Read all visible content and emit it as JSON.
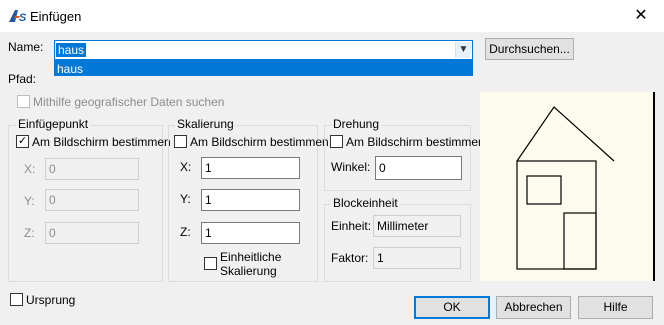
{
  "window": {
    "title": "Einfügen",
    "close_symbol": "✕"
  },
  "name_label": "Name:",
  "name_value": "haus",
  "dropdown_item": "haus",
  "browse_label": "Durchsuchen...",
  "path_label": "Pfad:",
  "geo_label": "Mithilfe geografischer Daten suchen",
  "insert_point": {
    "title": "Einfügepunkt",
    "onscreen_label": "Am Bildschirm bestimmen",
    "x_label": "X:",
    "x_value": "0",
    "y_label": "Y:",
    "y_value": "0",
    "z_label": "Z:",
    "z_value": "0"
  },
  "scale": {
    "title": "Skalierung",
    "onscreen_label": "Am Bildschirm bestimmen",
    "x_label": "X:",
    "x_value": "1",
    "y_label": "Y:",
    "y_value": "1",
    "z_label": "Z:",
    "z_value": "1",
    "uniform_line1": "Einheitliche",
    "uniform_line2": "Skalierung"
  },
  "rotation": {
    "title": "Drehung",
    "onscreen_label": "Am Bildschirm bestimmen",
    "angle_label": "Winkel:",
    "angle_value": "0"
  },
  "block_unit": {
    "title": "Blockeinheit",
    "unit_label": "Einheit:",
    "unit_value": "Millimeter",
    "factor_label": "Faktor:",
    "factor_value": "1"
  },
  "origin_label": "Ursprung",
  "buttons": {
    "ok": "OK",
    "cancel": "Abbrechen",
    "help": "Hilfe"
  },
  "checks": {
    "insert_onscreen": true,
    "scale_onscreen": false,
    "rotation_onscreen": false,
    "uniform": false,
    "origin": false,
    "geo": false
  },
  "colors": {
    "accent": "#0078d7",
    "preview_bg": "#fdfbee"
  }
}
